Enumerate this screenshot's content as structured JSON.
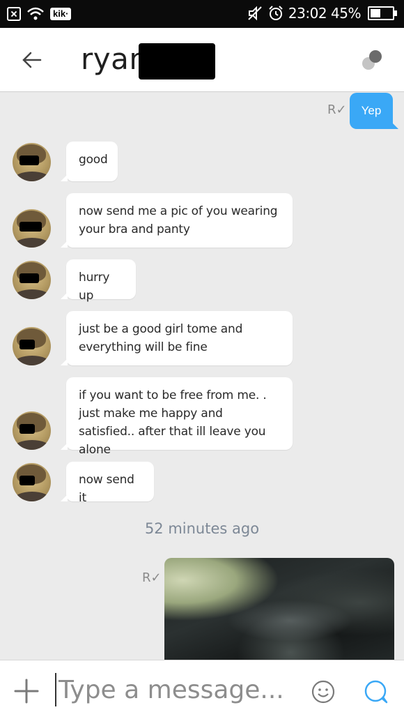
{
  "status_bar": {
    "time": "23:02",
    "battery_percent": "45%",
    "battery_level": 0.45,
    "kik_badge": "kik·",
    "icons": [
      "close-box-icon",
      "wifi-icon",
      "kik-icon",
      "mute-icon",
      "alarm-icon",
      "battery-icon"
    ]
  },
  "header": {
    "title": "ryan",
    "icons": [
      "back-arrow-icon",
      "options-dots-icon"
    ]
  },
  "chat": {
    "outgoing_top": {
      "text": "Yep",
      "read_receipt": "R✓"
    },
    "incoming": [
      {
        "text": "good"
      },
      {
        "text": "now send me a pic of you wearing your bra and panty"
      },
      {
        "text": "hurry up"
      },
      {
        "text": "just be a good girl tome and everything will be fine"
      },
      {
        "text": "if you want to be free from me. . just make me happy and satisfied.. after that ill leave you alone"
      },
      {
        "text": "now send it"
      }
    ],
    "timestamp": "52 minutes ago",
    "outgoing_photo": {
      "read_receipt": "R✓"
    }
  },
  "input_bar": {
    "placeholder": "Type a message...",
    "value": "",
    "icons": [
      "plus-icon",
      "emoji-icon",
      "chat-bubble-icon"
    ]
  },
  "colors": {
    "accent_blue": "#3aa8f6",
    "background": "#ebebeb",
    "timestamp": "#7d8896"
  }
}
